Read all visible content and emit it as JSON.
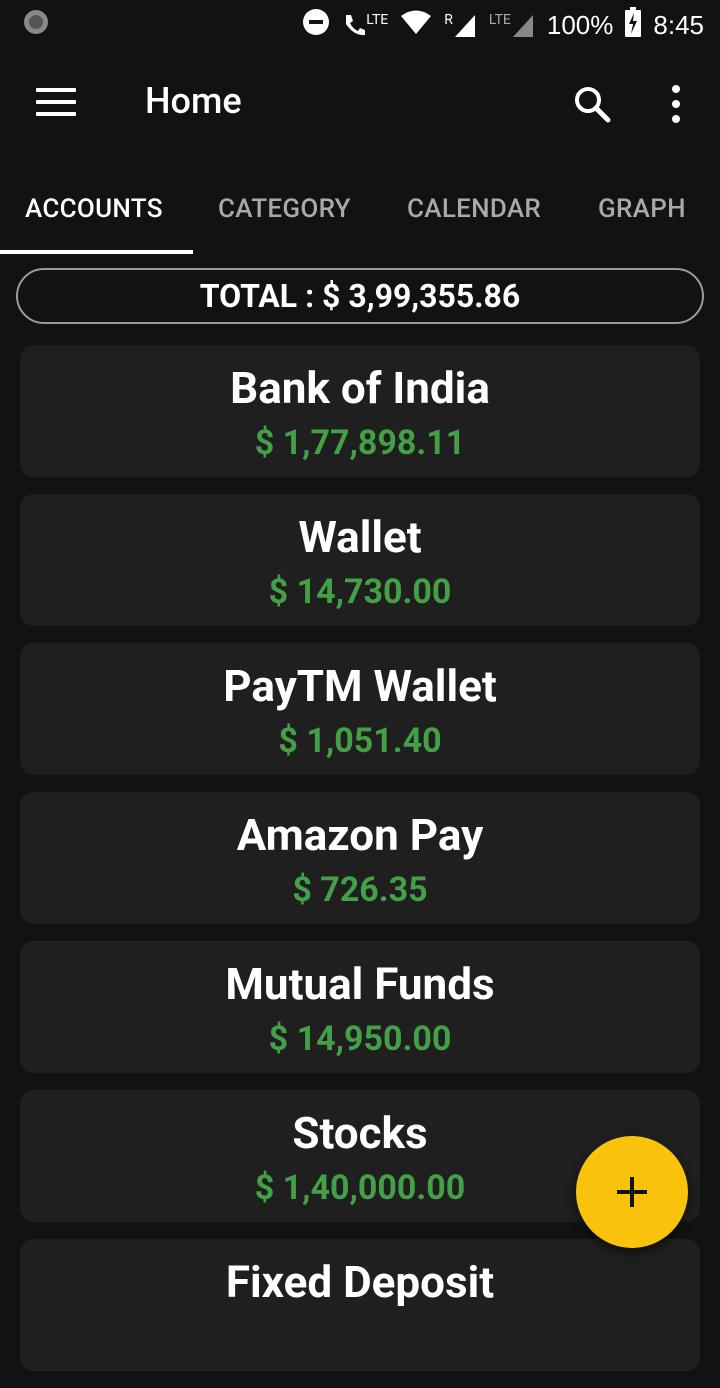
{
  "status_bar": {
    "lte_label": "LTE",
    "roaming_label": "R",
    "lte2_label": "LTE",
    "battery": "100%",
    "time": "8:45"
  },
  "app_bar": {
    "title": "Home"
  },
  "tabs": [
    {
      "label": "ACCOUNTS",
      "active": true
    },
    {
      "label": "CATEGORY",
      "active": false
    },
    {
      "label": "CALENDAR",
      "active": false
    },
    {
      "label": "GRAPH",
      "active": false
    }
  ],
  "total": "TOTAL : $ 3,99,355.86",
  "accounts": [
    {
      "name": "Bank of India",
      "amount": "$ 1,77,898.11"
    },
    {
      "name": "Wallet",
      "amount": "$ 14,730.00"
    },
    {
      "name": "PayTM Wallet",
      "amount": "$ 1,051.40"
    },
    {
      "name": "Amazon Pay",
      "amount": "$ 726.35"
    },
    {
      "name": "Mutual Funds",
      "amount": "$ 14,950.00"
    },
    {
      "name": "Stocks",
      "amount": "$ 1,40,000.00"
    },
    {
      "name": "Fixed Deposit",
      "amount": ""
    }
  ],
  "icons": {
    "menu": "menu-icon",
    "search": "search-icon",
    "more": "more-vert-icon",
    "fab": "plus-icon"
  },
  "colors": {
    "background": "#121212",
    "card": "#1f1f1f",
    "amount_green": "#43a047",
    "fab_yellow": "#f9c30c"
  }
}
